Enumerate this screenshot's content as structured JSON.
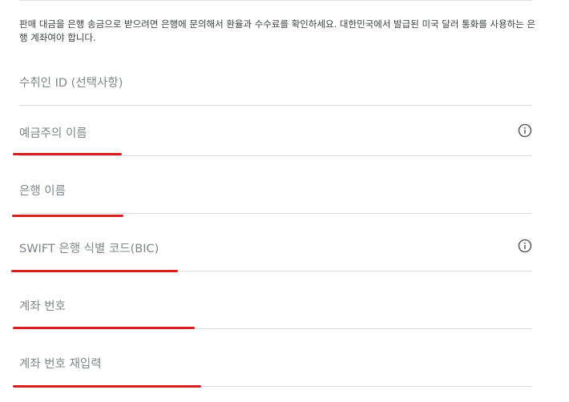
{
  "notice": "판매 대금을 은행 송금으로 받으려면 은행에 문의해서 환율과 수수료를 확인하세요. 대한민국에서 발급된 미국 달러 통화를 사용하는 은행 계좌여야 합니다.",
  "fields": {
    "beneficiary_id": {
      "placeholder": "수취인 ID (선택사항)"
    },
    "account_holder": {
      "placeholder": "예금주의 이름"
    },
    "bank_name": {
      "placeholder": "은행 이름"
    },
    "swift": {
      "placeholder": "SWIFT 은행 식별 코드(BIC)"
    },
    "account_number": {
      "placeholder": "계좌 번호"
    },
    "account_number_confirm": {
      "placeholder": "계좌 번호 재입력"
    }
  },
  "icons": {
    "account_holder_info": "info-icon",
    "swift_info": "info-icon"
  },
  "colors": {
    "annotation": "#d42020",
    "icon": "#5f6368",
    "placeholder": "#80868b"
  }
}
